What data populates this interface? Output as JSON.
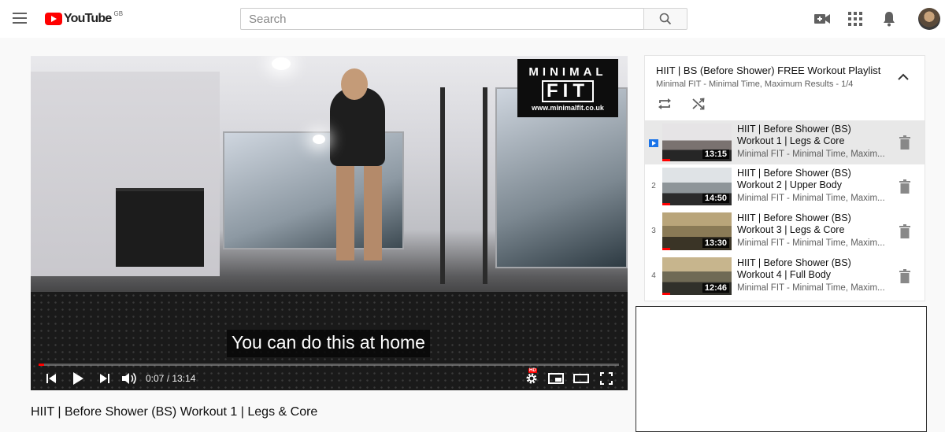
{
  "header": {
    "logo_text": "YouTube",
    "logo_region": "GB",
    "search_placeholder": "Search",
    "icons": [
      "menu-icon",
      "search-icon",
      "create-video-icon",
      "apps-grid-icon",
      "notifications-bell-icon",
      "avatar"
    ]
  },
  "player": {
    "watermark": {
      "line1": "MINIMAL",
      "line2": "FIT",
      "line3": "www.minimalfit.co.uk"
    },
    "caption": "You can do this at home",
    "time_current": "0:07",
    "time_sep": " / ",
    "time_total": "13:14",
    "progress_fraction": 0.009,
    "hd_badge": "HD"
  },
  "video": {
    "title": "HIIT | Before Shower (BS) Workout 1 | Legs & Core"
  },
  "playlist": {
    "title": "HIIT | BS (Before Shower) FREE Workout Playlist",
    "channel": "Minimal FIT - Minimal Time, Maximum Results",
    "position": "1/4",
    "items": [
      {
        "index": "▶",
        "title": "HIIT | Before Shower (BS) Workout 1 | Legs & Core",
        "channel": "Minimal FIT - Minimal Time, Maxim...",
        "duration": "13:15",
        "active": true
      },
      {
        "index": "2",
        "title": "HIIT | Before Shower (BS) Workout 2 | Upper Body",
        "channel": "Minimal FIT - Minimal Time, Maxim...",
        "duration": "14:50",
        "active": false
      },
      {
        "index": "3",
        "title": "HIIT | Before Shower (BS) Workout 3 | Legs & Core",
        "channel": "Minimal FIT - Minimal Time, Maxim...",
        "duration": "13:30",
        "active": false
      },
      {
        "index": "4",
        "title": "HIIT | Before Shower (BS) Workout 4 | Full Body",
        "channel": "Minimal FIT - Minimal Time, Maxim...",
        "duration": "12:46",
        "active": false
      }
    ]
  },
  "colors": {
    "brand_red": "#ff0000",
    "text_primary": "#0f0f0f",
    "text_secondary": "#606060",
    "active_row": "#e8e8e8"
  }
}
